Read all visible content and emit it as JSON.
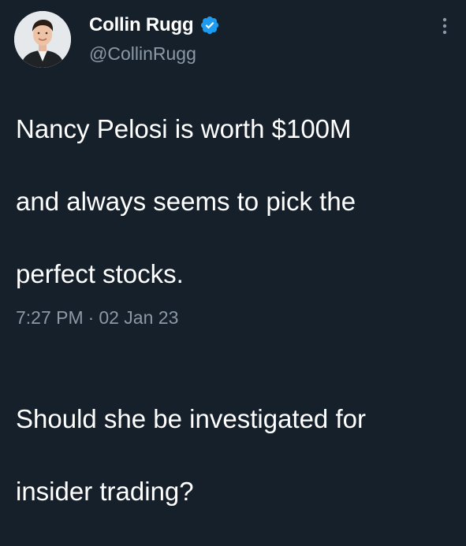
{
  "tweet": {
    "author": {
      "display_name": "Collin Rugg",
      "handle": "@CollinRugg",
      "verified": true,
      "avatar_icon": "user-avatar-photo"
    },
    "text_lines": [
      "Nancy Pelosi is worth $100M",
      "and always seems to pick the",
      "perfect stocks.",
      "",
      "Should she be investigated for",
      "insider trading?"
    ],
    "time": "7:27 PM",
    "separator": "·",
    "date": "02 Jan 23",
    "more_icon": "more-vertical-icon"
  },
  "colors": {
    "background": "#15202b",
    "text": "#ffffff",
    "secondary_text": "#8b98a5",
    "verified_badge": "#1d9bf0"
  }
}
